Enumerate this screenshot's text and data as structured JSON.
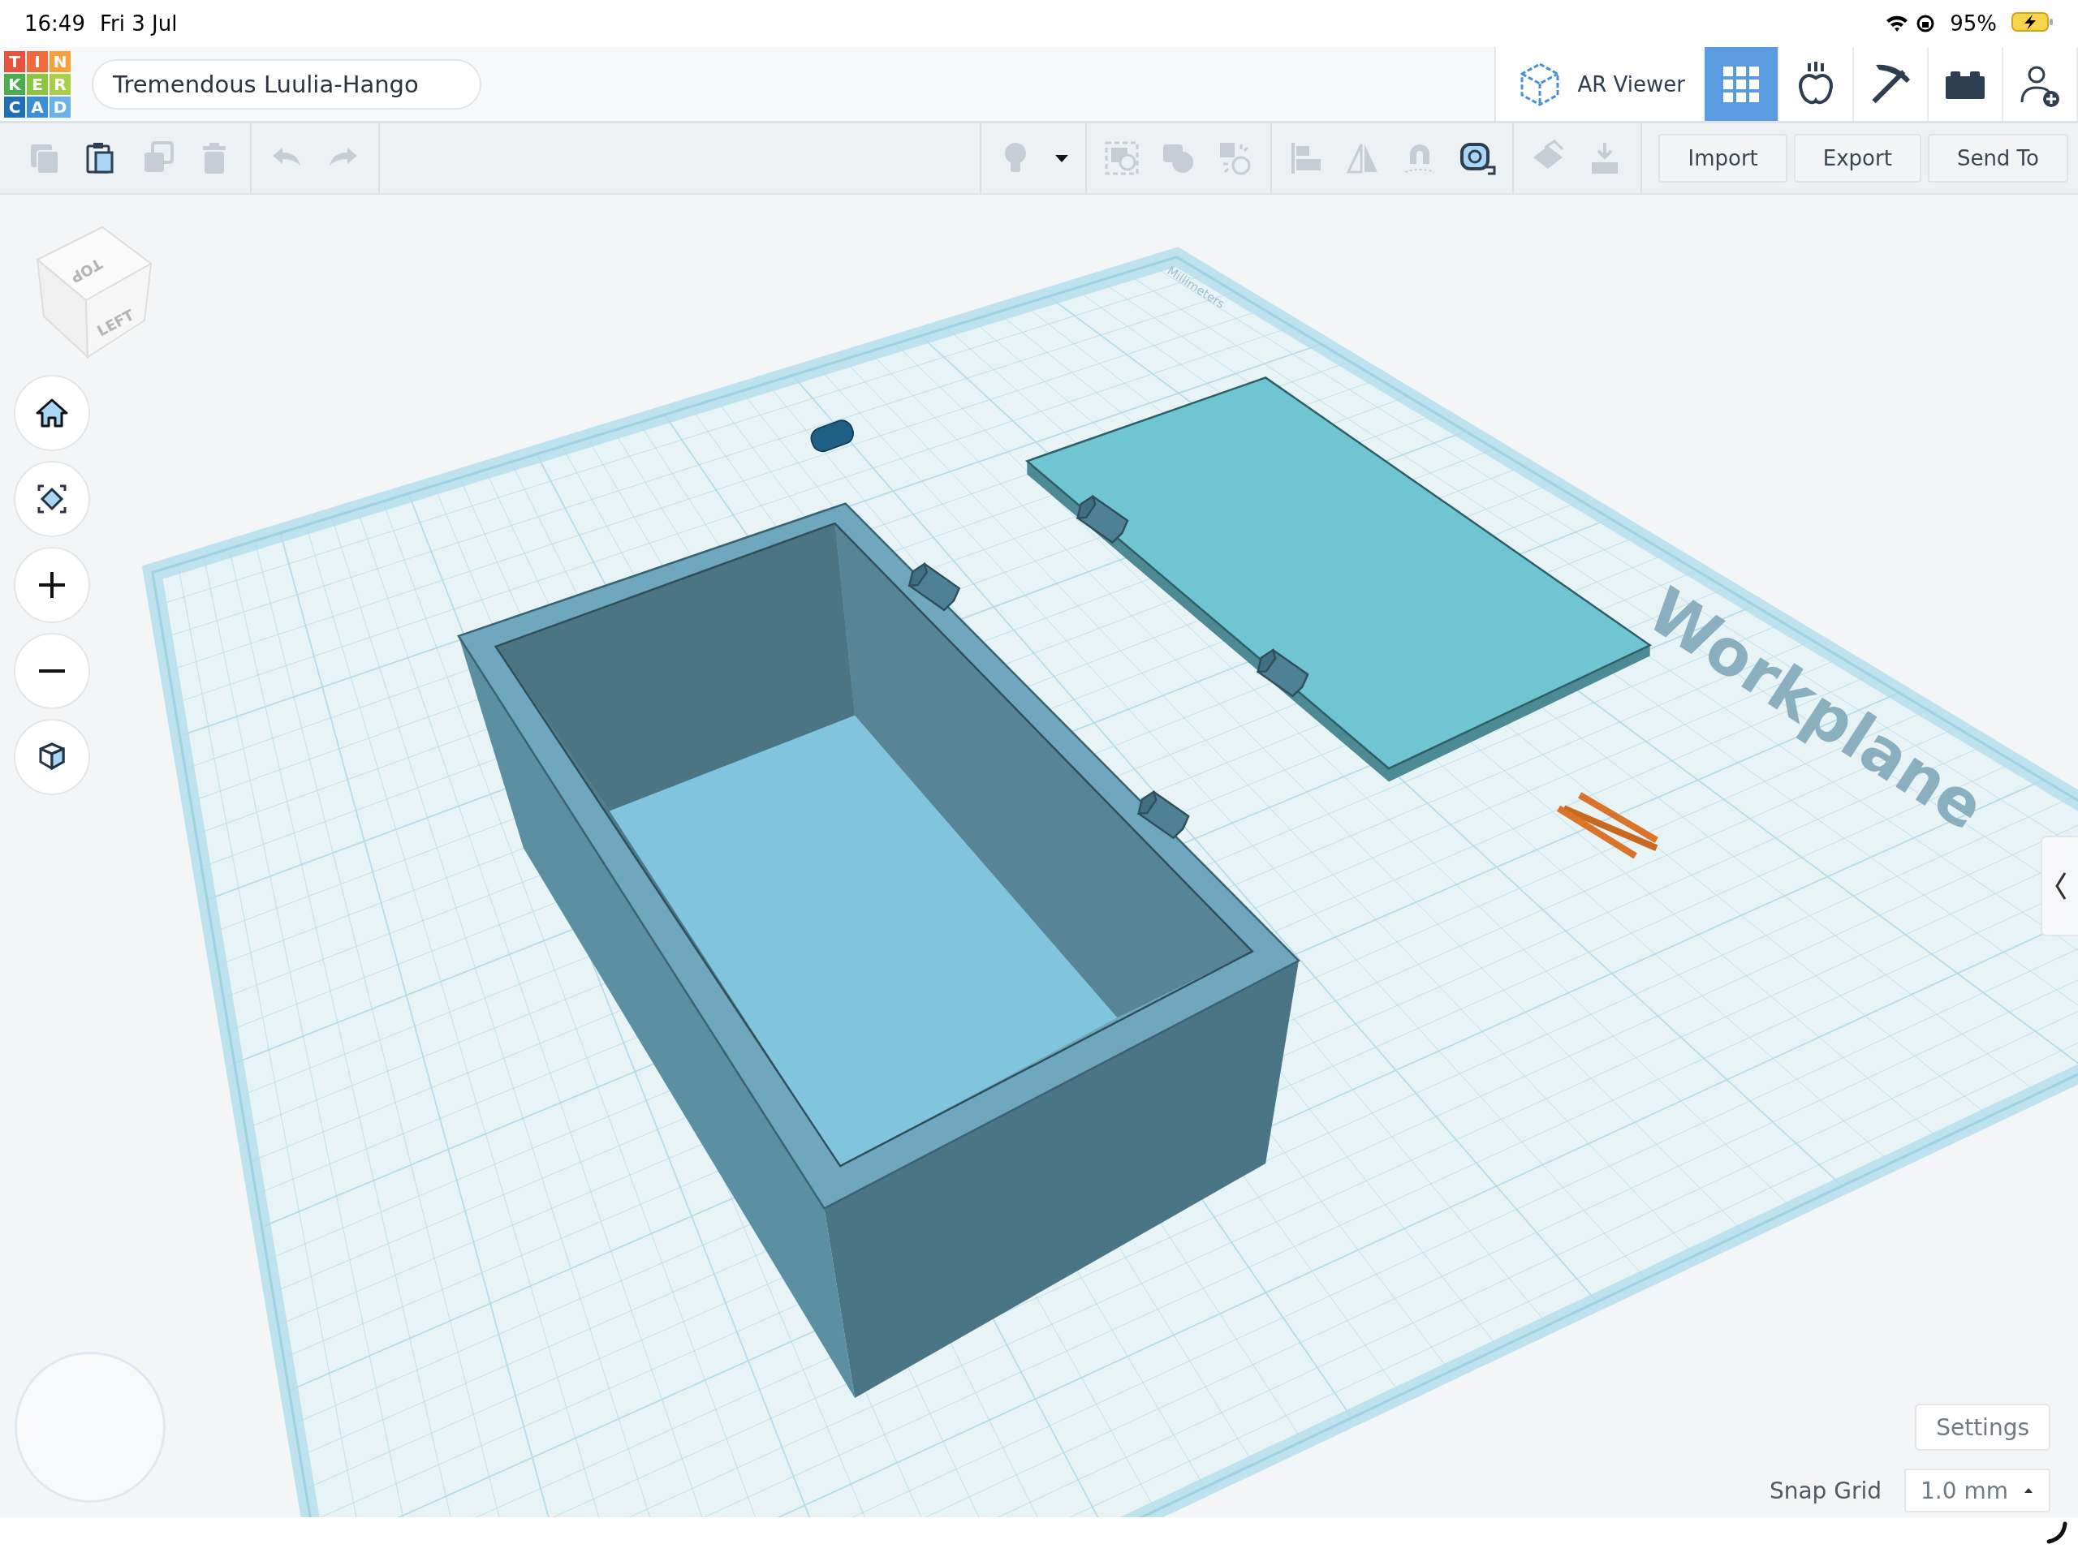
{
  "status_bar": {
    "time": "16:49",
    "date": "Fri 3 Jul",
    "battery": "95%"
  },
  "header": {
    "logo": [
      {
        "letter": "T",
        "color": "#e8513b"
      },
      {
        "letter": "I",
        "color": "#f06a3a"
      },
      {
        "letter": "N",
        "color": "#f5a13c"
      },
      {
        "letter": "K",
        "color": "#4aae4f"
      },
      {
        "letter": "E",
        "color": "#8cc63f"
      },
      {
        "letter": "R",
        "color": "#a8cf45"
      },
      {
        "letter": "C",
        "color": "#1f6fb6"
      },
      {
        "letter": "A",
        "color": "#3a8fd8"
      },
      {
        "letter": "D",
        "color": "#69b1e6"
      }
    ],
    "project_name": "Tremendous Luulia-Hango",
    "ar_viewer": "AR Viewer",
    "modes": [
      {
        "kind": "grid",
        "selected": true
      },
      {
        "kind": "sim",
        "selected": false
      },
      {
        "kind": "pickaxe",
        "selected": false
      },
      {
        "kind": "brick",
        "selected": false
      },
      {
        "kind": "user-add",
        "selected": false
      }
    ]
  },
  "toolbar": {
    "groups": [
      [
        {
          "kind": "copy",
          "disabled": true
        },
        {
          "kind": "paste",
          "disabled": false
        },
        {
          "kind": "duplicate",
          "disabled": true
        },
        {
          "kind": "delete",
          "disabled": true
        }
      ],
      [
        {
          "kind": "undo",
          "disabled": true
        },
        {
          "kind": "redo",
          "disabled": true
        }
      ],
      [
        {
          "kind": "light",
          "disabled": true
        },
        {
          "kind": "dropdown",
          "disabled": false
        }
      ],
      [
        {
          "kind": "group",
          "disabled": true
        },
        {
          "kind": "solid",
          "disabled": true
        },
        {
          "kind": "hole",
          "disabled": true
        }
      ],
      [
        {
          "kind": "align",
          "disabled": true
        },
        {
          "kind": "mirror",
          "disabled": true
        },
        {
          "kind": "magnet",
          "disabled": true
        },
        {
          "kind": "ruler",
          "disabled": false
        }
      ],
      [
        {
          "kind": "place",
          "disabled": true
        },
        {
          "kind": "drop",
          "disabled": true
        }
      ]
    ],
    "buttons": [
      "Import",
      "Export",
      "Send To"
    ]
  },
  "view_cube": {
    "faces": [
      "TOP",
      "LEFT"
    ]
  },
  "nav_buttons": [
    {
      "kind": "home"
    },
    {
      "kind": "fit"
    },
    {
      "kind": "zoom-in"
    },
    {
      "kind": "zoom-out"
    },
    {
      "kind": "ortho"
    }
  ],
  "scene": {
    "workplane_label": "Workplane",
    "units_label": "Millimeters"
  },
  "settings": {
    "button": "Settings",
    "snap_grid_label": "Snap Grid",
    "snap_grid_value": "1.0 mm"
  }
}
